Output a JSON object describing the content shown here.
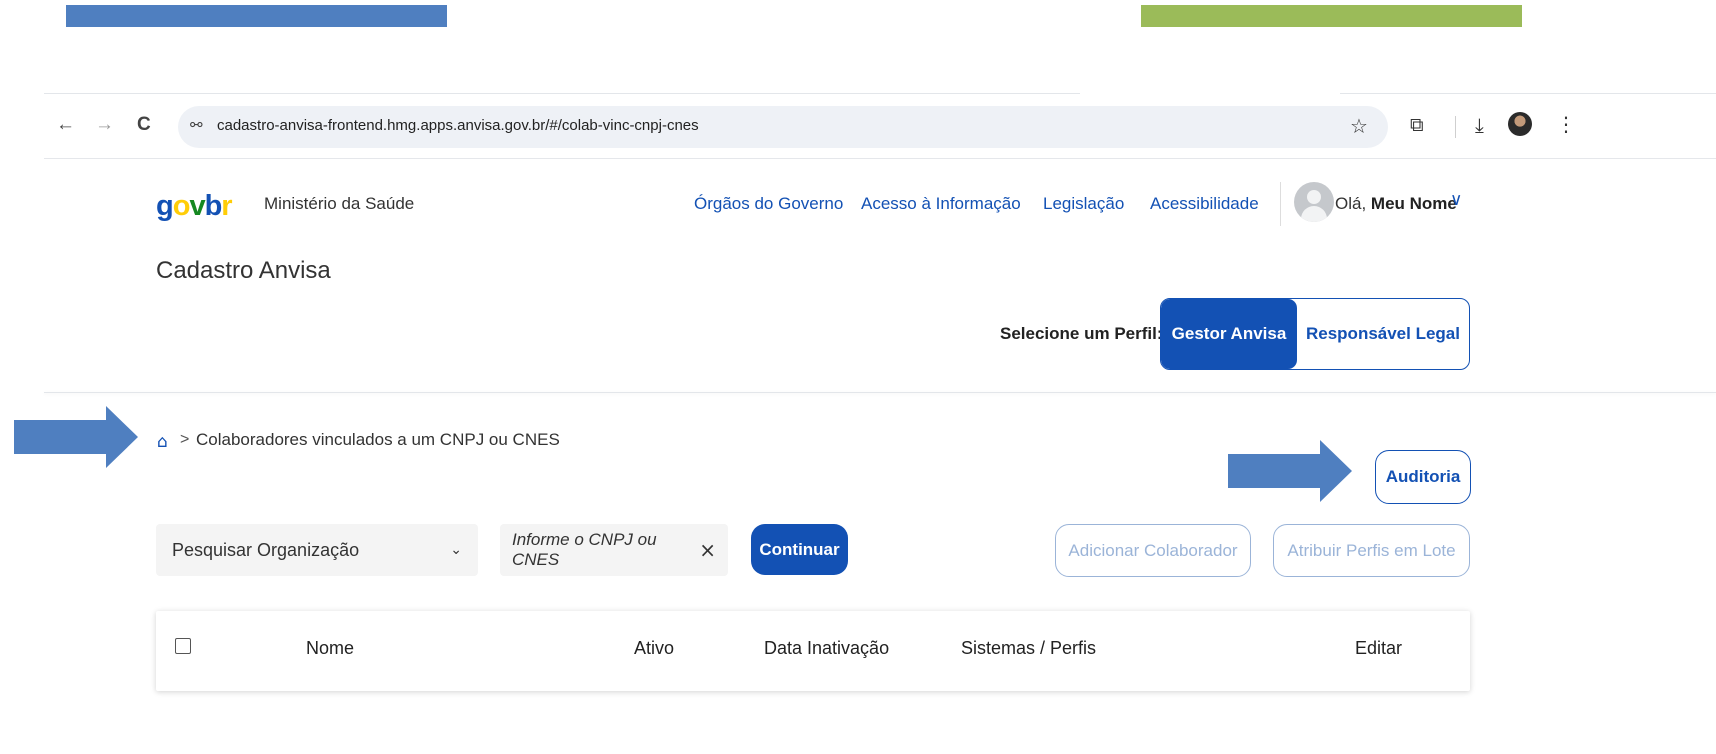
{
  "browser": {
    "back_glyph": "←",
    "forward_glyph": "→",
    "reload_glyph": "C",
    "site_info_glyph": "⚯",
    "url": "cadastro-anvisa-frontend.hmg.apps.anvisa.gov.br/#/colab-vinc-cnpj-cnes",
    "star_glyph": "☆",
    "extensions_glyph": "⧉",
    "download_glyph": "⤓",
    "menu_glyph": "⋮"
  },
  "header": {
    "logo": {
      "g": "g",
      "o": "o",
      "v": "v",
      "b": "b",
      "r": "r"
    },
    "ministry": "Ministério da Saúde",
    "links": [
      "Órgãos do Governo",
      "Acesso à Informação",
      "Legislação",
      "Acessibilidade"
    ],
    "greeting": "Olá,",
    "user_name": "Meu Nome",
    "chevron": "∨",
    "app_title": "Cadastro Anvisa"
  },
  "profile": {
    "label": "Selecione um Perfil:",
    "options": [
      "Gestor Anvisa",
      "Responsável Legal"
    ],
    "selected": "Gestor Anvisa"
  },
  "breadcrumb": {
    "home_glyph": "⌂",
    "separator": ">",
    "current": "Colaboradores vinculados a um CNPJ ou CNES"
  },
  "actions": {
    "auditoria": "Auditoria",
    "adicionar": "Adicionar Colaborador",
    "atribuir": "Atribuir Perfis em Lote"
  },
  "filters": {
    "organization_select": "Pesquisar Organização",
    "caret": "⌄",
    "cnpj_placeholder": "Informe o CNPJ ou CNES",
    "clear_glyph": "×",
    "continue": "Continuar"
  },
  "table": {
    "columns": [
      "Nome",
      "Ativo",
      "Data Inativação",
      "Sistemas / Perfis",
      "Editar"
    ]
  },
  "colors": {
    "primary": "#1351b4",
    "annotation_arrow": "#4f7fc0",
    "annotation_bar_left": "#4f7fc0",
    "annotation_bar_right": "#9bbb59"
  }
}
